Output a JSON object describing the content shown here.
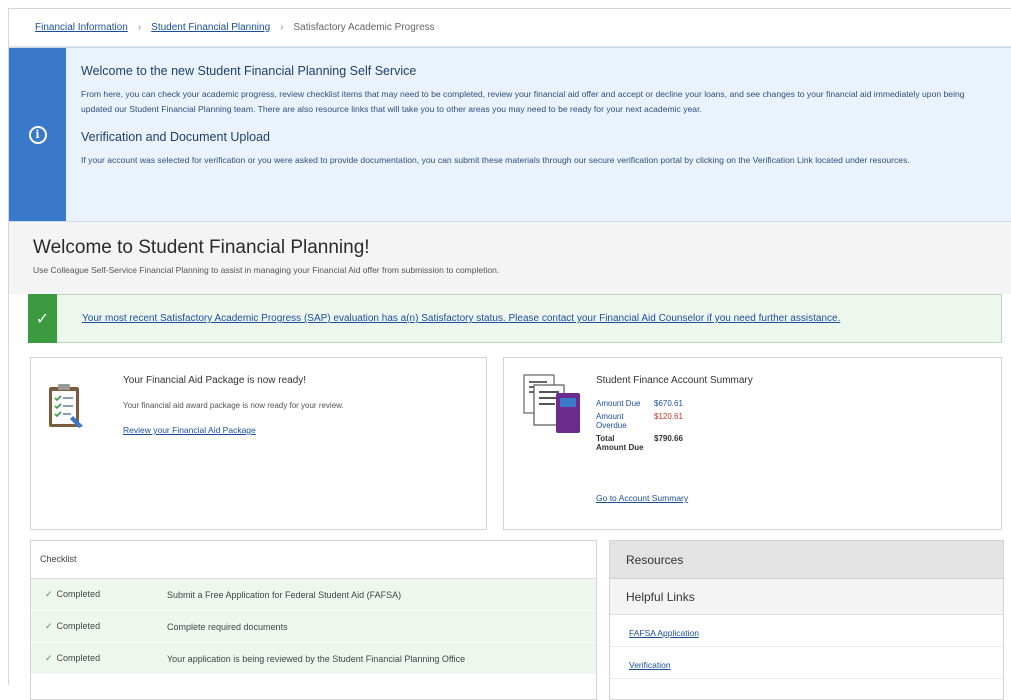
{
  "breadcrumb": {
    "items": [
      "Financial Information",
      "Student Financial Planning",
      "Satisfactory Academic Progress"
    ]
  },
  "notice": {
    "heading1": "Welcome to the new Student Financial Planning Self Service",
    "text1": "From here, you can check your academic progress, review checklist items that may need to be completed, review your financial aid offer and accept or decline your loans, and see changes to your financial aid immediately upon being updated our Student Financial Planning team. There are also resource links that will take you to other areas you may need to be ready for your next academic year.",
    "heading2": "Verification and Document Upload",
    "text2": "If your account was selected for verification or you were asked to provide documentation, you can submit these materials through our secure verification portal by clicking on the Verification Link located under resources."
  },
  "hero": {
    "title": "Welcome to Student Financial Planning!",
    "subtitle": "Use Colleague Self-Service Financial Planning to assist in managing your Financial Aid offer from submission to completion."
  },
  "sap_alert": {
    "text": "Your most recent Satisfactory Academic Progress (SAP) evaluation has a(n) Satisfactory status. Please contact your Financial Aid Counselor if you need further assistance."
  },
  "aid_card": {
    "title": "Your Financial Aid Package is now ready!",
    "text": "Your financial aid award package is now ready for your review.",
    "link": "Review your Financial Aid Package"
  },
  "account_card": {
    "title": "Student Finance Account Summary",
    "amount_due_label": "Amount Due",
    "amount_due_value": "$670.61",
    "amount_overdue_label_1": "Amount",
    "amount_overdue_label_2": "Overdue",
    "amount_overdue_value": "$120.61",
    "total_label_1": "Total",
    "total_label_2": "Amount Due",
    "total_value": "$790.66",
    "link": "Go to Account Summary"
  },
  "checklist": {
    "title": "Checklist",
    "rows": [
      {
        "status": "Completed",
        "item": "Submit a Free Application for Federal Student Aid (FAFSA)"
      },
      {
        "status": "Completed",
        "item": "Complete required documents"
      },
      {
        "status": "Completed",
        "item": "Your application is being reviewed by the Student Financial Planning Office"
      }
    ]
  },
  "resources": {
    "title": "Resources",
    "subtitle": "Helpful Links",
    "links": [
      "FAFSA Application",
      "Verification"
    ]
  },
  "colors": {
    "info_bar": "#3a78c9",
    "success": "#3c9a41",
    "link": "#1a4f9c",
    "overdue": "#c0392b"
  }
}
